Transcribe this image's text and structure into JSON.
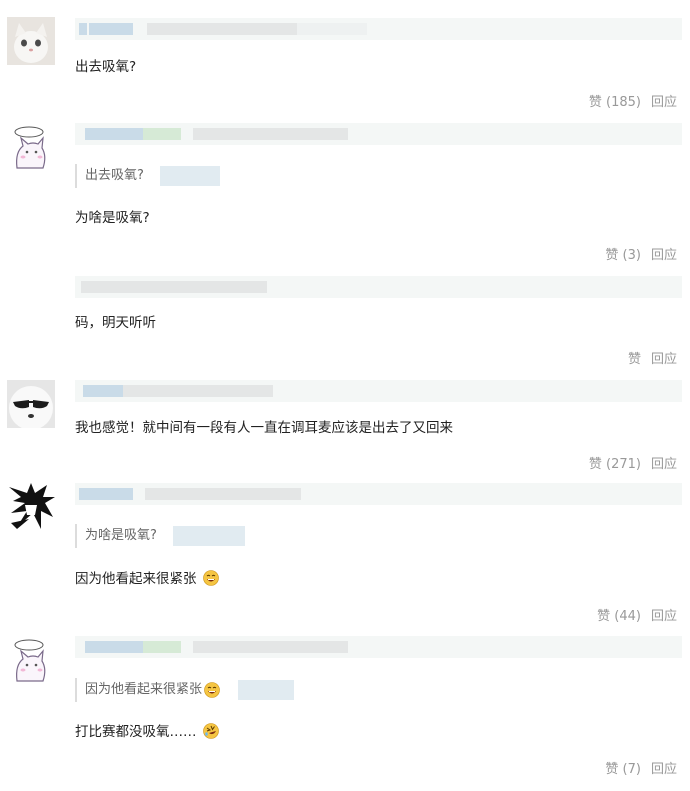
{
  "comments": [
    {
      "text": "出去吸氧?",
      "like_label": "赞 (185)",
      "reply_label": "回应"
    },
    {
      "quote": "出去吸氧?",
      "text": "为啥是吸氧?",
      "like_label": "赞 (3)",
      "reply_label": "回应"
    },
    {
      "text": "码，明天听听",
      "like_label": "赞",
      "reply_label": "回应"
    },
    {
      "text": "我也感觉！就中间有一段有人一直在调耳麦应该是出去了又回来",
      "like_label": "赞 (271)",
      "reply_label": "回应"
    },
    {
      "quote": "为啥是吸氧?",
      "text": "因为他看起来很紧张",
      "like_label": "赞 (44)",
      "reply_label": "回应"
    },
    {
      "quote": "因为他看起来很紧张",
      "text": "打比赛都没吸氧……",
      "like_label": "赞 (7)",
      "reply_label": "回应"
    }
  ],
  "colors": {
    "bar_bg": "#f4f7f6",
    "blur_blue": "#c9dbe8",
    "blur_gray": "#e4e6e6",
    "blur_green": "#d6ead6",
    "action_text": "#999999"
  }
}
